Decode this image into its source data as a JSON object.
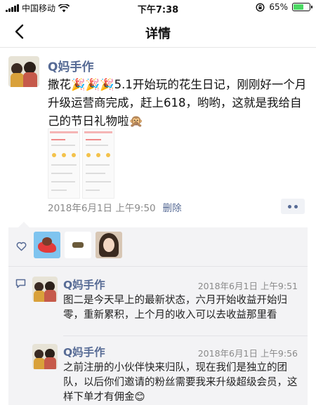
{
  "status_bar": {
    "carrier": "中国移动",
    "time": "下午7:38",
    "battery_text": "65%",
    "battery_level": 0.65,
    "battery_color": "#4cd964"
  },
  "nav": {
    "title": "详情",
    "back_icon": "chevron-left-icon"
  },
  "post": {
    "author": "Q妈手作",
    "text": "撒花🎉🎉🎉5.1开始玩的花生日记，刚刚好一个月升级运营商完成，赶上618，哟哟，这就是我给自己的节日礼物啦🙊",
    "time": "2018年6月1日 上午9:50",
    "delete_label": "删除",
    "image_count": 2
  },
  "likes": {
    "icon": "heart-icon",
    "avatar_count": 3
  },
  "comments": [
    {
      "name": "Q妈手作",
      "time": "2018年6月1日 上午9:51",
      "text": "图二是今天早上的最新状态，六月开始收益开始归零，重新累积，上个月的收入可以去收益那里看"
    },
    {
      "name": "Q妈手作",
      "time": "2018年6月1日 上午9:56",
      "text": "之前注册的小伙伴快来归队，现在我们是独立的团队，以后你们邀请的粉丝需要我来升级超级会员，这样下单才有佣金😊"
    }
  ],
  "colors": {
    "link": "#576b95",
    "meta": "#8a8a8a",
    "comment_bg": "#f3f3f5"
  }
}
